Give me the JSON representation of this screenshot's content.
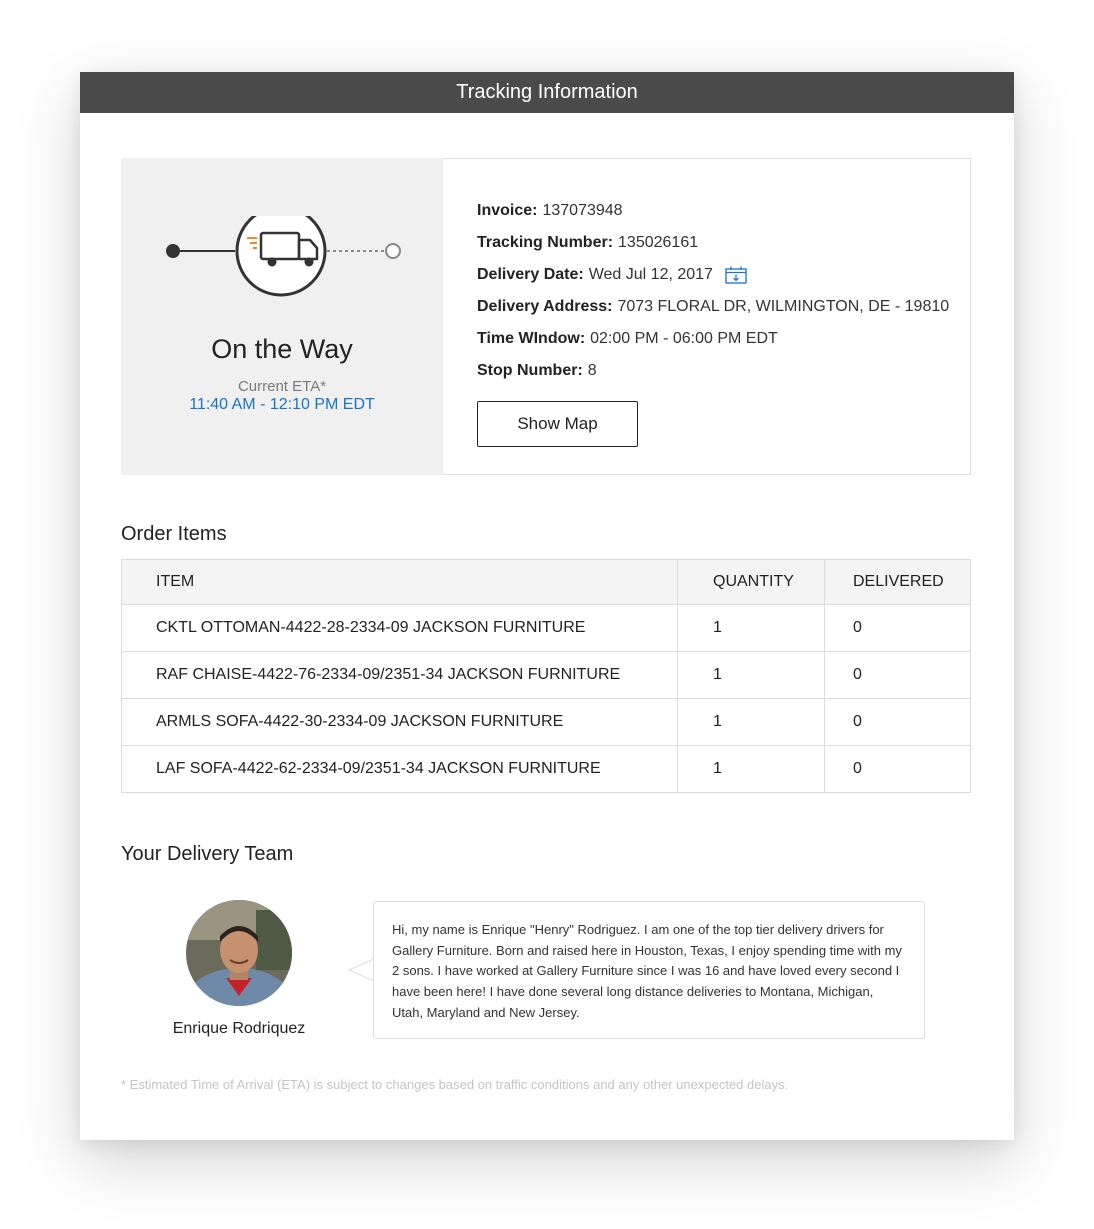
{
  "header": {
    "title": "Tracking Information"
  },
  "status": {
    "title": "On the Way",
    "eta_label": "Current ETA*",
    "eta_value": "11:40 AM - 12:10 PM EDT",
    "icons": [
      "truck-icon",
      "timeline-start-dot",
      "timeline-end-dot"
    ],
    "colors": {
      "eta": "#1a73c8",
      "speed_lines": "#f08a24"
    }
  },
  "details": {
    "invoice_label": "Invoice:",
    "invoice_value": "137073948",
    "tracking_label": "Tracking Number:",
    "tracking_value": "135026161",
    "delivery_date_label": "Delivery Date:",
    "delivery_date_value": "Wed Jul 12, 2017",
    "address_label": "Delivery Address:",
    "address_value": "7073 FLORAL DR, WILMINGTON, DE - 19810",
    "time_window_label": "Time WIndow:",
    "time_window_value": "02:00 PM - 06:00 PM EDT",
    "stop_label": "Stop Number:",
    "stop_value": "8",
    "show_map_label": "Show Map",
    "calendar_icon": "calendar-download-icon"
  },
  "order_items": {
    "title": "Order Items",
    "headers": {
      "item": "ITEM",
      "quantity": "QUANTITY",
      "delivered": "DELIVERED"
    },
    "rows": [
      {
        "item": "CKTL OTTOMAN-4422-28-2334-09 JACKSON FURNITURE",
        "quantity": "1",
        "delivered": "0"
      },
      {
        "item": "RAF CHAISE-4422-76-2334-09/2351-34 JACKSON FURNITURE",
        "quantity": "1",
        "delivered": "0"
      },
      {
        "item": "ARMLS SOFA-4422-30-2334-09 JACKSON FURNITURE",
        "quantity": "1",
        "delivered": "0"
      },
      {
        "item": "LAF SOFA-4422-62-2334-09/2351-34 JACKSON FURNITURE",
        "quantity": "1",
        "delivered": "0"
      }
    ]
  },
  "team": {
    "title": "Your Delivery Team",
    "driver_name": "Enrique Rodriquez",
    "bio": "Hi, my name is Enrique \"Henry\" Rodriguez. I am one of the top tier delivery drivers for Gallery Furniture. Born and raised here in Houston, Texas, I enjoy spending time with my 2 sons. I have worked at Gallery Furniture since I was 16 and have loved every second I have been here! I have done several long distance deliveries to Montana, Michigan, Utah, Maryland and New Jersey."
  },
  "footnote": "* Estimated Time of Arrival (ETA) is subject to changes based on traffic conditions and any other unexpected delays."
}
